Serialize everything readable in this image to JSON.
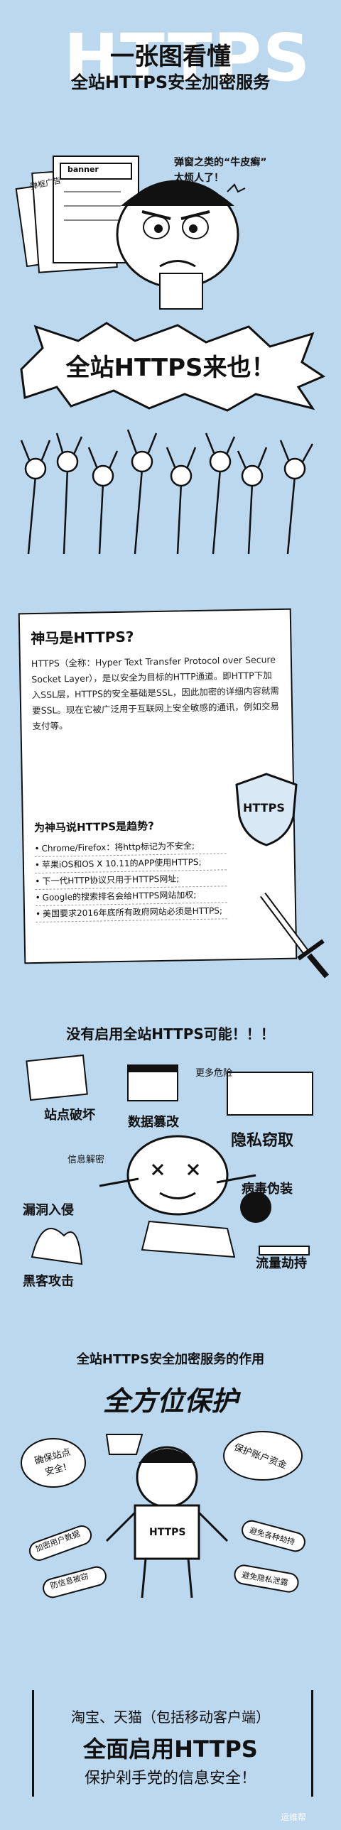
{
  "header": {
    "bg_word": "HTTPS",
    "title": "一张图看懂",
    "subtitle": "全站HTTPS安全加密服务"
  },
  "intro": {
    "bubble_line1": "弹窗之类的“牛皮癣”",
    "bubble_line2": "太烦人了！",
    "sign_text": "弹框广告",
    "banner_text": "banner",
    "coming": "全站HTTPS来也！"
  },
  "what_is": {
    "title": "神马是HTTPS?",
    "body": "HTTPS（全称：Hyper Text Transfer Protocol over Secure Socket Layer），是以安全为目标的HTTP通道。即HTTP下加入SSL层，HTTPS的安全基础是SSL，因此加密的详细内容就需要SSL。现在它被广泛用于互联网上安全敏感的通讯，例如交易支付等。",
    "shield_label": "HTTPS",
    "trend_title": "为神马说HTTPS是趋势?",
    "trends": [
      "Chrome/Firefox：将http标记为不安全;",
      "苹果iOS和OS X 10.11的APP使用HTTPS;",
      "下一代HTTP协议只用于HTTPS网址;",
      "Google的搜索排名会给HTTPS网站加权;",
      "美国要求2016年底所有政府网站必须是HTTPS;"
    ]
  },
  "risks": {
    "title": "没有启用全站HTTPS可能！！！",
    "items": {
      "site_break": "站点破坏",
      "data_tamper": "数据篡改",
      "more_risk": "更多危险",
      "privacy": "隐私窃取",
      "decrypt": "信息解密",
      "virus": "病毒伪装",
      "leak": "漏洞入侵",
      "hijack": "流量劫持",
      "hacker": "黑客攻击"
    }
  },
  "benefits": {
    "title": "全站HTTPS安全加密服务的作用",
    "headline": "全方位保护",
    "shirt_label": "HTTPS",
    "site_safe": "确保站点安全!",
    "account_funds": "保护账户资金",
    "user_data": "加密用户数据",
    "prevent_leak": "防信息被窃",
    "avoid_hijack": "避免各种劫持",
    "avoid_privacy": "避免隐私泄露"
  },
  "footer": {
    "line1": "淘宝、天猫（包括移动客户端）",
    "line2": "全面启用HTTPS",
    "line3": "保护剁手党的信息安全！",
    "watermark": "运维帮"
  }
}
